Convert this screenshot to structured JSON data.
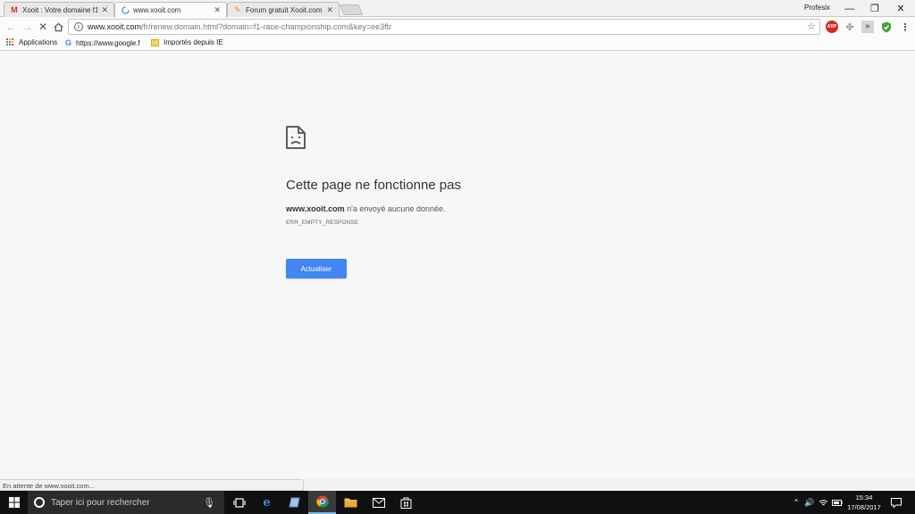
{
  "tabs": [
    {
      "title": "Xooit : Votre domaine f1-",
      "favicon": "gmail-icon"
    },
    {
      "title": "www.xooit.com",
      "favicon": "loading-spinner-icon"
    },
    {
      "title": "Forum gratuit Xooit.com",
      "favicon": "xooit-icon"
    }
  ],
  "profile_name": "Profesix",
  "window_controls": {
    "minimize": "—",
    "maximize": "❐",
    "close": "✕"
  },
  "omnibox": {
    "host": "www.xooit.com",
    "path": "/fr/renew.domain.html?domain=f1-race-championship.com&key=ee3fb"
  },
  "bookmarks": [
    {
      "label": "Applications",
      "icon": "apps-grid-icon"
    },
    {
      "label": "https://www.google.f",
      "icon": "google-icon"
    },
    {
      "label": "Importés depuis IE",
      "icon": "folder-icon"
    }
  ],
  "error": {
    "title": "Cette page ne fonctionne pas",
    "host": "www.xooit.com",
    "message": " n'a envoyé aucune donnée.",
    "code": "ERR_EMPTY_RESPONSE",
    "button_label": "Actualiser"
  },
  "status_text": "En attente de www.xooit.com...",
  "taskbar": {
    "search_placeholder": "Taper ici pour rechercher",
    "time": "15:34",
    "date": "17/08/2017"
  },
  "colors": {
    "primary_button": "#4285f4",
    "taskbar": "#101010"
  }
}
